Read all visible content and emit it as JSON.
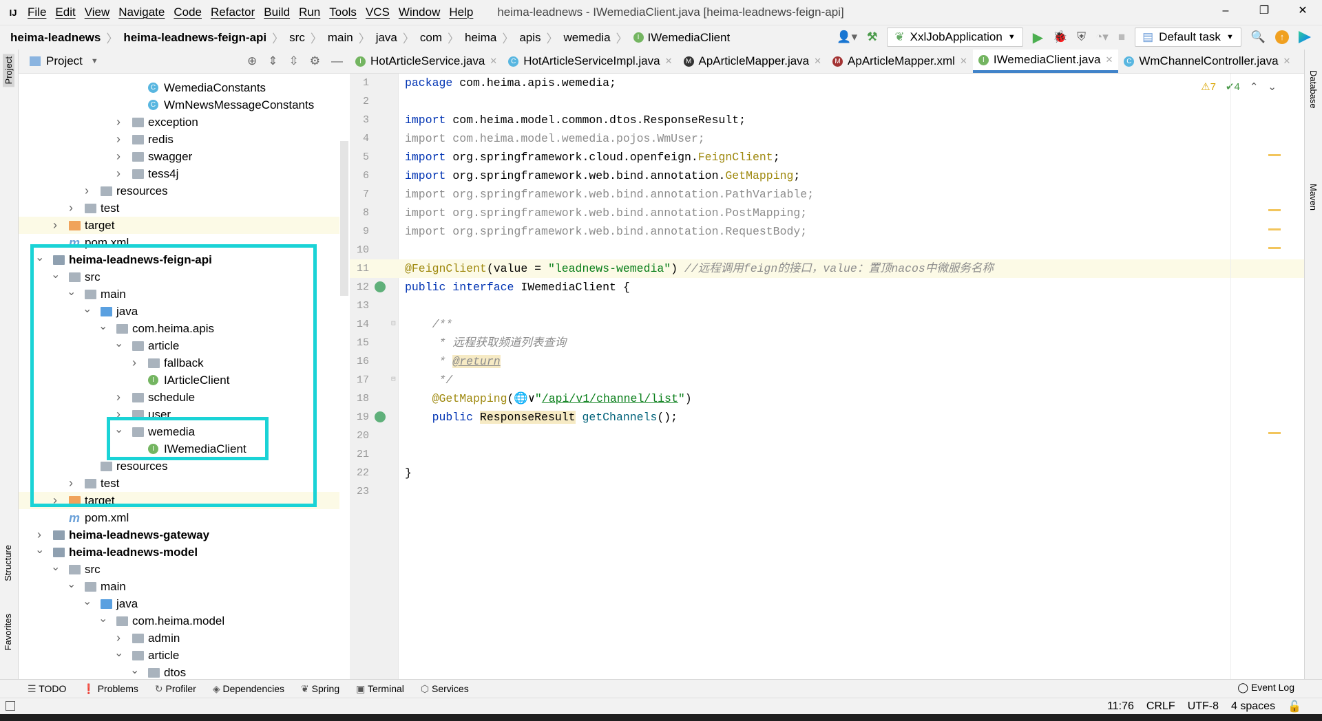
{
  "title_bar": {
    "menu": [
      "File",
      "Edit",
      "View",
      "Navigate",
      "Code",
      "Refactor",
      "Build",
      "Run",
      "Tools",
      "VCS",
      "Window",
      "Help"
    ],
    "window_title": "heima-leadnews - IWemediaClient.java [heima-leadnews-feign-api]",
    "minimize": "–",
    "maximize": "❐",
    "close": "✕"
  },
  "breadcrumb": [
    {
      "label": "heima-leadnews",
      "bold": true
    },
    {
      "label": "heima-leadnews-feign-api",
      "bold": true
    },
    {
      "label": "src"
    },
    {
      "label": "main"
    },
    {
      "label": "java"
    },
    {
      "label": "com"
    },
    {
      "label": "heima"
    },
    {
      "label": "apis"
    },
    {
      "label": "wemedia"
    },
    {
      "label": "IWemediaClient",
      "icon": "interface-icon"
    }
  ],
  "toolbar": {
    "run_config": "XxlJobApplication",
    "task": "Default task"
  },
  "left_strip": {
    "project": "Project",
    "structure": "Structure",
    "favorites": "Favorites"
  },
  "right_strip": {
    "database": "Database",
    "maven": "Maven"
  },
  "project_panel": {
    "title": "Project"
  },
  "tree": [
    {
      "label": "WemediaConstants",
      "depth": 6,
      "icon": "class-c"
    },
    {
      "label": "WmNewsMessageConstants",
      "depth": 6,
      "icon": "class-c"
    },
    {
      "label": "exception",
      "depth": 5,
      "icon": "package",
      "arrow": "right"
    },
    {
      "label": "redis",
      "depth": 5,
      "icon": "package",
      "arrow": "right"
    },
    {
      "label": "swagger",
      "depth": 5,
      "icon": "package",
      "arrow": "right"
    },
    {
      "label": "tess4j",
      "depth": 5,
      "icon": "package",
      "arrow": "right"
    },
    {
      "label": "resources",
      "depth": 3,
      "icon": "res",
      "arrow": "right"
    },
    {
      "label": "test",
      "depth": 2,
      "icon": "folder",
      "arrow": "right"
    },
    {
      "label": "target",
      "depth": 1,
      "icon": "target",
      "arrow": "right",
      "highlight": true
    },
    {
      "label": "pom.xml",
      "depth": 1,
      "icon": "maven"
    },
    {
      "label": "heima-leadnews-feign-api",
      "depth": 0,
      "icon": "module",
      "arrow": "down",
      "bold": true
    },
    {
      "label": "src",
      "depth": 1,
      "icon": "folder",
      "arrow": "down"
    },
    {
      "label": "main",
      "depth": 2,
      "icon": "folder",
      "arrow": "down"
    },
    {
      "label": "java",
      "depth": 3,
      "icon": "src",
      "arrow": "down"
    },
    {
      "label": "com.heima.apis",
      "depth": 4,
      "icon": "package",
      "arrow": "down"
    },
    {
      "label": "article",
      "depth": 5,
      "icon": "package",
      "arrow": "down"
    },
    {
      "label": "fallback",
      "depth": 6,
      "icon": "package",
      "arrow": "right"
    },
    {
      "label": "IArticleClient",
      "depth": 6,
      "icon": "class-i"
    },
    {
      "label": "schedule",
      "depth": 5,
      "icon": "package",
      "arrow": "right"
    },
    {
      "label": "user",
      "depth": 5,
      "icon": "package",
      "arrow": "right"
    },
    {
      "label": "wemedia",
      "depth": 5,
      "icon": "package",
      "arrow": "down"
    },
    {
      "label": "IWemediaClient",
      "depth": 6,
      "icon": "class-i"
    },
    {
      "label": "resources",
      "depth": 3,
      "icon": "res"
    },
    {
      "label": "test",
      "depth": 2,
      "icon": "folder",
      "arrow": "right"
    },
    {
      "label": "target",
      "depth": 1,
      "icon": "target",
      "arrow": "right",
      "highlight": true
    },
    {
      "label": "pom.xml",
      "depth": 1,
      "icon": "maven"
    },
    {
      "label": "heima-leadnews-gateway",
      "depth": 0,
      "icon": "module",
      "arrow": "right",
      "bold": true
    },
    {
      "label": "heima-leadnews-model",
      "depth": 0,
      "icon": "module",
      "arrow": "down",
      "bold": true
    },
    {
      "label": "src",
      "depth": 1,
      "icon": "folder",
      "arrow": "down"
    },
    {
      "label": "main",
      "depth": 2,
      "icon": "folder",
      "arrow": "down"
    },
    {
      "label": "java",
      "depth": 3,
      "icon": "src",
      "arrow": "down"
    },
    {
      "label": "com.heima.model",
      "depth": 4,
      "icon": "package",
      "arrow": "down"
    },
    {
      "label": "admin",
      "depth": 5,
      "icon": "package",
      "arrow": "right"
    },
    {
      "label": "article",
      "depth": 5,
      "icon": "package",
      "arrow": "down"
    },
    {
      "label": "dtos",
      "depth": 6,
      "icon": "package",
      "arrow": "down"
    }
  ],
  "tabs": [
    {
      "label": "HotArticleService.java",
      "icon": "I",
      "color": "#74b561"
    },
    {
      "label": "HotArticleServiceImpl.java",
      "icon": "C",
      "color": "#58b6e0"
    },
    {
      "label": "ApArticleMapper.java",
      "icon": "M",
      "color": "#333333"
    },
    {
      "label": "ApArticleMapper.xml",
      "icon": "M",
      "color": "#a33333"
    },
    {
      "label": "IWemediaClient.java",
      "icon": "I",
      "color": "#74b561",
      "active": true
    },
    {
      "label": "WmChannelController.java",
      "icon": "C",
      "color": "#58b6e0"
    }
  ],
  "inspections": {
    "warnings": "⚠7",
    "weak": "✔4"
  },
  "code": [
    [
      [
        "package ",
        "kw"
      ],
      [
        "com.heima.apis.wemedia;",
        ""
      ]
    ],
    [],
    [
      [
        "import ",
        "kw"
      ],
      [
        "com.heima.model.common.dtos.ResponseResult;",
        ""
      ]
    ],
    [
      [
        "import com.heima.model.wemedia.pojos.WmUser;",
        "gray"
      ]
    ],
    [
      [
        "import ",
        "kw"
      ],
      [
        "org.springframework.cloud.openfeign.",
        ""
      ],
      [
        "FeignClient",
        "ann"
      ],
      [
        ";",
        ""
      ]
    ],
    [
      [
        "import ",
        "kw"
      ],
      [
        "org.springframework.web.bind.annotation.",
        ""
      ],
      [
        "GetMapping",
        "ann"
      ],
      [
        ";",
        ""
      ]
    ],
    [
      [
        "import org.springframework.web.bind.annotation.PathVariable;",
        "gray"
      ]
    ],
    [
      [
        "import org.springframework.web.bind.annotation.PostMapping;",
        "gray"
      ]
    ],
    [
      [
        "import org.springframework.web.bind.annotation.RequestBody;",
        "gray"
      ]
    ],
    [],
    [
      [
        "@FeignClient",
        "ann"
      ],
      [
        "(value = ",
        ""
      ],
      [
        "\"leadnews-wemedia\"",
        "str"
      ],
      [
        ") ",
        ""
      ],
      [
        "//远程调用feign的接口，value：置顶nacos中微服务名称",
        "cm"
      ]
    ],
    [
      [
        "public interface ",
        "kw"
      ],
      [
        "IWemediaClient {",
        ""
      ]
    ],
    [],
    [
      [
        "    /**",
        "cm"
      ]
    ],
    [
      [
        "     * 远程获取频道列表查询",
        "cm"
      ]
    ],
    [
      [
        "     * ",
        "cm"
      ],
      [
        "@return",
        "tag"
      ]
    ],
    [
      [
        "     */",
        "cm"
      ]
    ],
    [
      [
        "    ",
        ""
      ],
      [
        "@GetMapping",
        "ann"
      ],
      [
        "(🌐∨",
        ""
      ],
      [
        "\"",
        "str"
      ],
      [
        "/api/v1/channel/list",
        "url"
      ],
      [
        "\"",
        "str"
      ],
      [
        ")",
        ""
      ]
    ],
    [
      [
        "    public ",
        "kw"
      ],
      [
        "ResponseResult",
        "hlw"
      ],
      [
        " ",
        ""
      ],
      [
        "getChannels",
        "fn"
      ],
      [
        "();",
        ""
      ]
    ],
    [],
    [],
    [
      [
        "}",
        ""
      ]
    ],
    []
  ],
  "bottom_tools": [
    "TODO",
    "Problems",
    "Profiler",
    "Dependencies",
    "Spring",
    "Terminal",
    "Services"
  ],
  "event_log": "Event Log",
  "status": {
    "position": "11:76",
    "line_sep": "CRLF",
    "encoding": "UTF-8",
    "indent": "4 spaces"
  }
}
